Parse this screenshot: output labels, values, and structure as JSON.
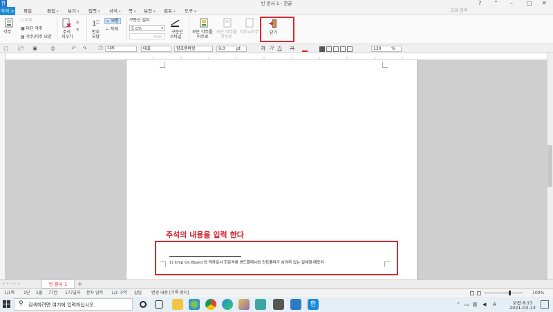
{
  "window": {
    "title": "빈 문서 1 - 한글",
    "app_logo": "한",
    "help_search_placeholder": "도움 검색"
  },
  "menu": {
    "annot_tab": "주석 ×",
    "items": [
      {
        "label": "파일",
        "has_arrow": false
      },
      {
        "label": "편집",
        "has_arrow": true
      },
      {
        "label": "보기",
        "has_arrow": true
      },
      {
        "label": "입력",
        "has_arrow": true
      },
      {
        "label": "서식",
        "has_arrow": true
      },
      {
        "label": "쪽",
        "has_arrow": true
      },
      {
        "label": "보안",
        "has_arrow": true
      },
      {
        "label": "검토",
        "has_arrow": true
      },
      {
        "label": "도구",
        "has_arrow": true
      }
    ]
  },
  "ribbon": {
    "footnote": "각주",
    "endnote": "미주",
    "multi_footnote": "다단 각주",
    "footnote_shape": "각주/미주 모양",
    "delete_note_1": "주석",
    "delete_note_2": "지우기",
    "number_shape_1": "번호",
    "number_shape_2": "모양",
    "normal": "보통",
    "small": "작게",
    "divider_length_label": "구분선 길이",
    "divider_length_value": "5 cm",
    "mm_unit": "mm",
    "divider_1": "구분선",
    "divider_2": "스타일",
    "all_notes_1": "모든 각주를",
    "all_notes_2": "미주로",
    "all_endnotes_1": "모든 미주를",
    "all_endnotes_2": "각주로",
    "swap": "각주↔미주",
    "close": "닫기"
  },
  "toolbar": {
    "style": "각주",
    "lang": "대표",
    "font": "함초롬바탕",
    "size": "9.0",
    "size_unit": "pt",
    "bold": "가",
    "italic": "가",
    "underline": "가",
    "strike": "가",
    "zoom": "130",
    "zoom_unit": "%"
  },
  "document": {
    "annotation_heading": "주석의 내용을 입력 한다",
    "footnote_text": "1) Chip On Board 의 약자로서 회로속에 낸드플래시와 컨트롤러가 숨겨져 있는 일체형 메모리"
  },
  "tabs": {
    "doc_tab": "빈 문서 1",
    "add": "+"
  },
  "status": [
    "1/1쪽",
    "1단",
    "1줄",
    "77칸",
    "177글자",
    "문자 입력",
    "1/1 구역",
    "삽입",
    "변경 내용 [기록 중지]"
  ],
  "status_zoom": "109%",
  "taskbar": {
    "search_placeholder": "검색하려면 여기에 입력하십시오.",
    "time": "오전 8:13",
    "date": "2021-03-13",
    "ime": "A"
  },
  "colors": {
    "accent": "#1e8bd6",
    "highlight": "#e0262c",
    "heading": "#d3222a"
  }
}
